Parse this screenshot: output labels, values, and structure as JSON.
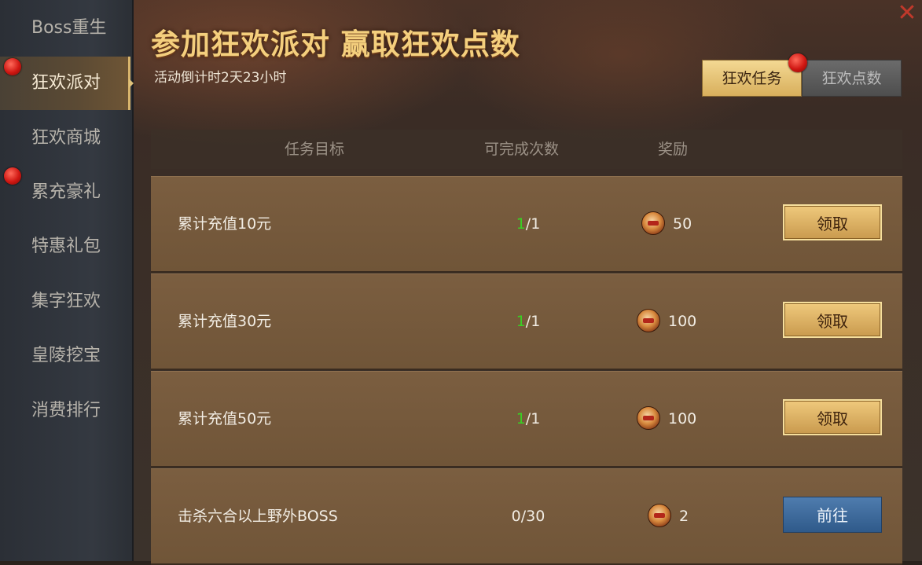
{
  "sidebar": {
    "items": [
      {
        "label": "Boss重生",
        "active": false,
        "dot": false
      },
      {
        "label": "狂欢派对",
        "active": true,
        "dot": true
      },
      {
        "label": "狂欢商城",
        "active": false,
        "dot": false
      },
      {
        "label": "累充豪礼",
        "active": false,
        "dot": true
      },
      {
        "label": "特惠礼包",
        "active": false,
        "dot": false
      },
      {
        "label": "集字狂欢",
        "active": false,
        "dot": false
      },
      {
        "label": "皇陵挖宝",
        "active": false,
        "dot": false
      },
      {
        "label": "消费排行",
        "active": false,
        "dot": false
      }
    ]
  },
  "header": {
    "title": "参加狂欢派对 赢取狂欢点数",
    "countdown": "活动倒计时2天23小时",
    "close_symbol": "✕"
  },
  "tabs": [
    {
      "label": "狂欢任务",
      "active": true
    },
    {
      "label": "狂欢点数",
      "active": false
    }
  ],
  "table": {
    "headers": [
      "任务目标",
      "可完成次数",
      "奖励"
    ],
    "rows": [
      {
        "name": "累计充值10元",
        "done": "1",
        "total": "/1",
        "reward": "50",
        "button": "领取",
        "button_type": "claim"
      },
      {
        "name": "累计充值30元",
        "done": "1",
        "total": "/1",
        "reward": "100",
        "button": "领取",
        "button_type": "claim"
      },
      {
        "name": "累计充值50元",
        "done": "1",
        "total": "/1",
        "reward": "100",
        "button": "领取",
        "button_type": "claim"
      },
      {
        "name": "击杀六合以上野外BOSS",
        "done": "",
        "total": "0/30",
        "reward": "2",
        "button": "前往",
        "button_type": "goto"
      }
    ]
  },
  "colors": {
    "accent_gold": "#f4cf7d",
    "done_green": "#39d023",
    "claim_button": "#e0b768",
    "goto_button": "#3e6a9c",
    "red_dot": "#d01712"
  }
}
